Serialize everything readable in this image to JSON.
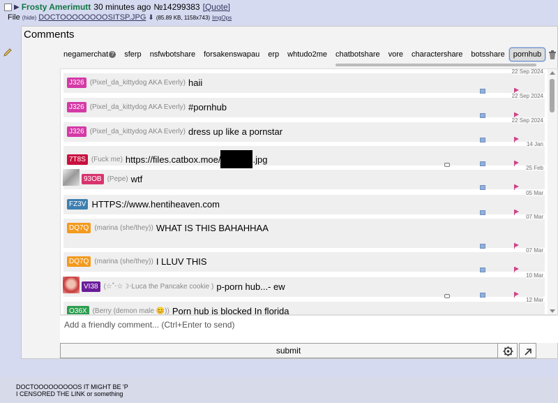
{
  "post": {
    "name": "Frosty Amerimutt",
    "time": "30 minutes ago",
    "number": "№14299383",
    "quote": "[Quote]",
    "file_label": "File",
    "hide": "(hide)",
    "filename": "DOCTOOOOOOOOSITSP.JPG",
    "download_icon": "download-icon",
    "file_meta": "(85.89 KB, 1158x743)",
    "imgops": "ImgOps",
    "comment_lines": [
      "DOCTOOOOOOOOOS IT MIGHT BE 'P",
      "I CENSORED THE LINK or something"
    ]
  },
  "comments_panel": {
    "title": "Comments",
    "tabs": [
      {
        "label": "negamerchat",
        "has_help": true
      },
      {
        "label": "sferp"
      },
      {
        "label": "nsfwbotshare"
      },
      {
        "label": "forsakenswapau"
      },
      {
        "label": "erp"
      },
      {
        "label": "whtudo2me"
      },
      {
        "label": "chatbotshare"
      },
      {
        "label": "vore"
      },
      {
        "label": "charactershare"
      },
      {
        "label": "botsshare"
      },
      {
        "label": "pornhub",
        "active": true
      }
    ],
    "help_glyph": "?",
    "add_tab": "+",
    "comments": [
      {
        "id": "J326",
        "id_color": "#d43aa6",
        "name": "(Pixel_da_kittydog AKA Everly)",
        "text": "haii",
        "date": "22 Sep 2024"
      },
      {
        "id": "J326",
        "id_color": "#d43aa6",
        "name": "(Pixel_da_kittydog AKA Everly)",
        "text": "#pornhub",
        "date": "22 Sep 2024"
      },
      {
        "id": "J326",
        "id_color": "#d43aa6",
        "name": "(Pixel_da_kittydog AKA Everly)",
        "text": "dress up like a pornstar",
        "date": "22 Sep 2024"
      },
      {
        "id": "7T8S",
        "id_color": "#c8103e",
        "name": "(Fuck me)",
        "text": "https://files.catbox.moe/",
        "text_after": ".jpg",
        "redacted": true,
        "date": "14 Jan"
      },
      {
        "id": "93OB",
        "id_color": "#d8336f",
        "name": "(Pepe)",
        "text": "wtf",
        "date": "25 Feb"
      },
      {
        "id": "FZ3V",
        "id_color": "#3d7fb0",
        "name": "",
        "text": "HTTPS://www.hentiheaven.com",
        "date": "05 Mar"
      },
      {
        "id": "DQ7Q",
        "id_color": "#f39a1f",
        "name": "(marina (she/they))",
        "text": "WHAT IS THIS BAHAHHAA",
        "date": "07 Mar"
      },
      {
        "id": "DQ7Q",
        "id_color": "#f39a1f",
        "name": "(marina (she/they))",
        "text": "I LLUV THIS",
        "date": "07 Mar"
      },
      {
        "id": "VI38",
        "id_color": "#6a1b9a",
        "name": "(☆˚‧☆☽‧Luca the Pancake cookie )",
        "text": "p-porn hub...- ew",
        "date": "10 Mar"
      },
      {
        "id": "O36X",
        "id_color": "#2e9d4f",
        "name": "(Berry (demon male 😊))",
        "text": "Porn hub is blocked In florida",
        "date": "12 Mar"
      }
    ],
    "input_placeholder": "Add a friendly comment... (Ctrl+Enter to send)",
    "submit_label": "submit",
    "icons": {
      "pencil": "pencil-icon",
      "trash": "trash-icon",
      "settings": "gear-icon",
      "expand": "expand-icon",
      "reply": "reply-icon",
      "report": "flag-icon",
      "comment": "speech-bubble-icon"
    }
  }
}
